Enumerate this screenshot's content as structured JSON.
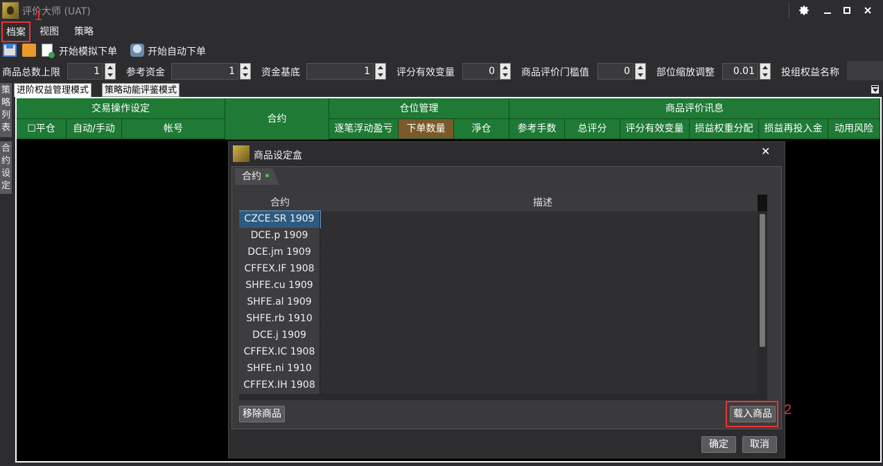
{
  "window": {
    "title": "评价大师 (UAT)"
  },
  "menu": {
    "archive": "档案",
    "view": "视图",
    "strategy": "策略"
  },
  "annotations": {
    "step1": "1",
    "step2": "2"
  },
  "toolbar": {
    "start_sim": "开始模拟下单",
    "start_auto": "开始自动下单"
  },
  "params": {
    "max_goods_label": "商品总数上限",
    "max_goods_value": "1",
    "ref_fund_label": "参考资金",
    "ref_fund_value": "1",
    "fund_base_label": "资金基底",
    "fund_base_value": "1",
    "score_var_label": "评分有效变量",
    "score_var_value": "0",
    "threshold_label": "商品评价门槛值",
    "threshold_value": "0",
    "scale_label": "部位缩放调整",
    "scale_value": "0.01",
    "portfolio_label": "投组权益名称"
  },
  "side_tabs": {
    "strategy_list": [
      "策",
      "略",
      "列",
      "表"
    ],
    "contract_settings": [
      "合",
      "约",
      "设",
      "定"
    ]
  },
  "tabs": {
    "advanced": "进阶权益管理模式",
    "eval": "策略动能评鉴模式"
  },
  "grid": {
    "group_trade": "交易操作设定",
    "contract": "合约",
    "group_position": "仓位管理",
    "group_eval": "商品评价讯息",
    "col_close": "☐平仓",
    "col_auto": "自动/手动",
    "col_account": "帐号",
    "col_pnl": "逐笔浮动盈亏",
    "col_order_qty": "下单数量",
    "col_net": "淨仓",
    "col_fee": "参考手数",
    "col_total_score": "总评分",
    "col_score_var": "评分有效变量",
    "col_weight": "损益权重分配",
    "col_reinvest": "损益再投入金",
    "col_risk": "动用风险"
  },
  "dialog": {
    "title": "商品设定盒",
    "close": "✕",
    "tab": "合约",
    "col_contract": "合约",
    "col_desc": "描述",
    "rows": [
      "CZCE.SR 1909",
      "DCE.p 1909",
      "DCE.jm 1909",
      "CFFEX.IF 1908",
      "SHFE.cu 1909",
      "SHFE.al 1909",
      "SHFE.rb 1910",
      "DCE.j 1909",
      "CFFEX.IC 1908",
      "SHFE.ni 1910",
      "CFFEX.IH 1908"
    ],
    "remove_btn": "移除商品",
    "load_btn": "载入商品",
    "ok_btn": "确定",
    "cancel_btn": "取消"
  }
}
